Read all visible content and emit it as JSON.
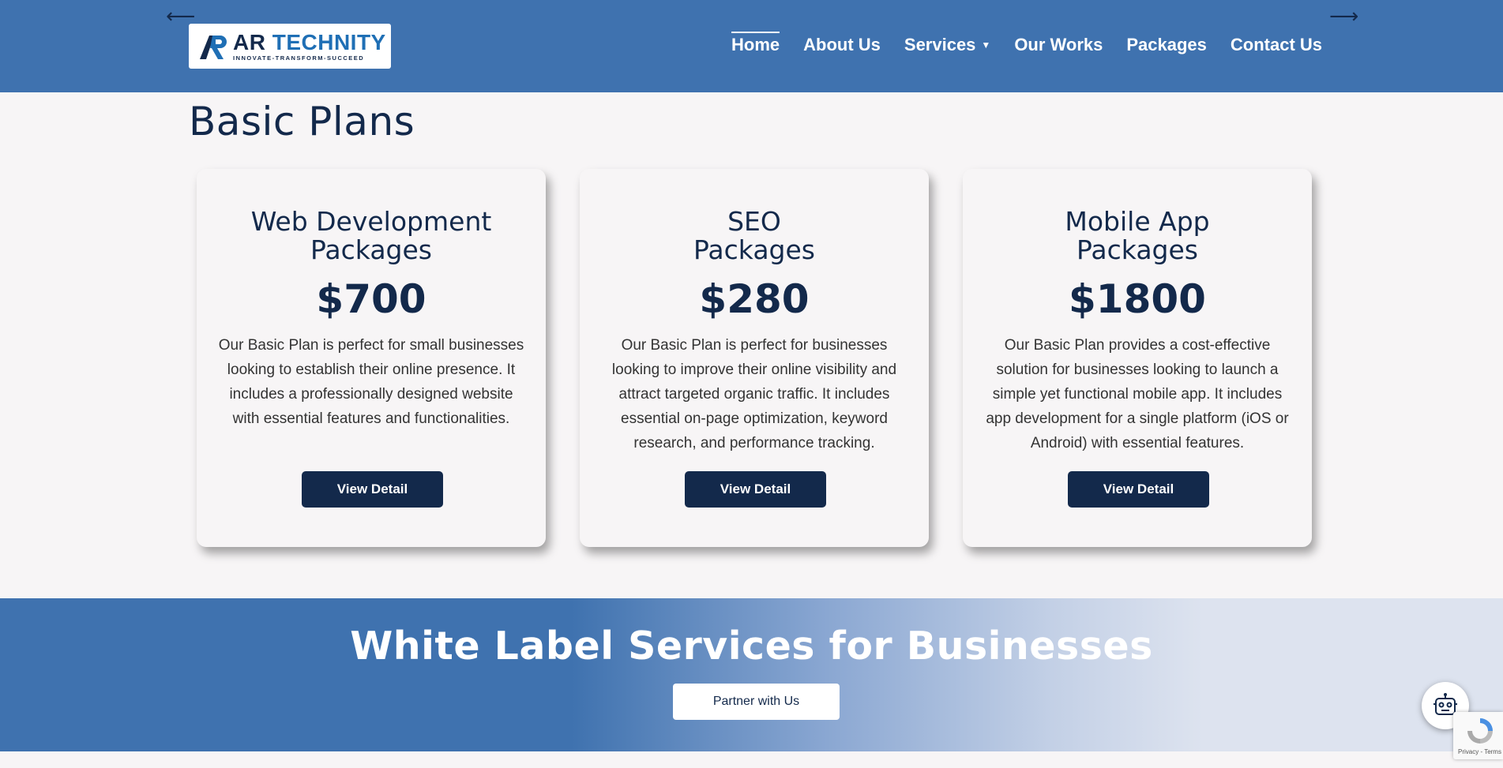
{
  "header": {
    "prev_arrow": "⟵",
    "next_arrow": "⟶",
    "logo": {
      "name_part1": "AR",
      "name_part2": "TECHNITY",
      "tagline": "INNOVATE-TRANSFORM-SUCCEED"
    },
    "nav": [
      {
        "label": "Home",
        "active": true
      },
      {
        "label": "About Us"
      },
      {
        "label": "Services",
        "has_caret": true
      },
      {
        "label": "Our Works"
      },
      {
        "label": "Packages"
      },
      {
        "label": "Contact Us"
      }
    ],
    "caret_icon": "chevron-down-icon"
  },
  "section": {
    "title": "Basic Plans"
  },
  "cards": [
    {
      "title": "Web Development\nPackages",
      "price": "$700",
      "description": "Our Basic Plan is perfect for small businesses looking to establish their online presence. It includes a professionally designed website with essential features and functionalities.",
      "button": "View Detail"
    },
    {
      "title": "SEO\nPackages",
      "price": "$280",
      "description": "Our Basic Plan is perfect for businesses looking to improve their online visibility and attract targeted organic traffic. It includes essential on-page optimization, keyword research, and performance tracking.",
      "button": "View Detail"
    },
    {
      "title": "Mobile App\nPackages",
      "price": "$1800",
      "description": "Our Basic Plan provides a cost-effective solution for businesses looking to launch a simple yet functional mobile app. It includes app development for a single platform (iOS or Android) with essential features.",
      "button": "View Detail"
    }
  ],
  "banner": {
    "title": "White Label Services for Businesses",
    "button": "Partner with Us"
  },
  "widgets": {
    "chatbot_icon": "robot-icon",
    "recaptcha_text": "Privacy - Terms"
  },
  "colors": {
    "header_bg": "#3f72af",
    "navy": "#13294b",
    "page_bg": "#f7f5f6"
  }
}
